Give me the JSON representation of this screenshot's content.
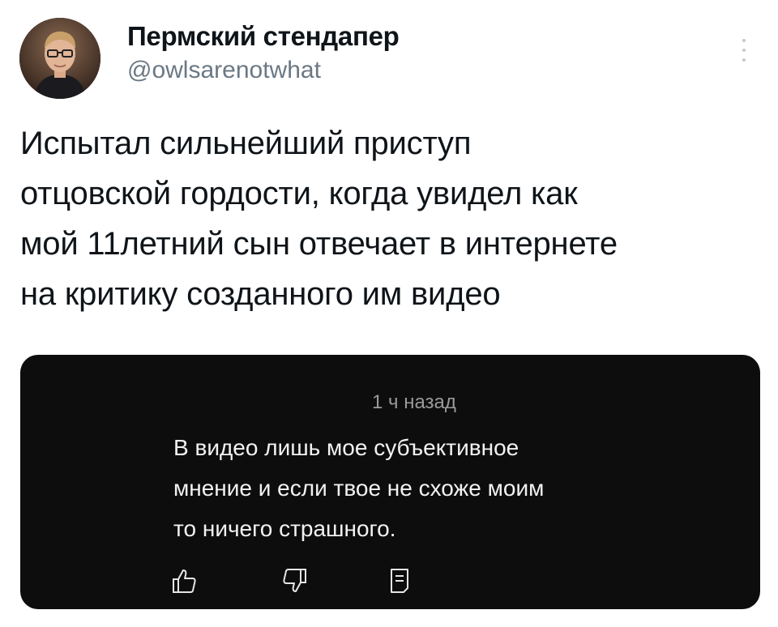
{
  "tweet": {
    "author": {
      "display_name": "Пермский стендапер",
      "handle": "@owlsarenotwhat",
      "avatar_icon": "user-avatar-photo"
    },
    "more_icon": "more-vertical-icon",
    "text": "Испытал сильнейший приступ\nотцовской гордости, когда увидел как\nмой 11летний сын отвечает в интернете\nна критику созданного им видео"
  },
  "embedded_comment": {
    "time": "1 ч назад",
    "text": "В видео лишь мое субъективное\nмнение и если твое не схоже моим\nто ничего страшного.",
    "actions": [
      {
        "icon": "thumbs-up-icon"
      },
      {
        "icon": "thumbs-down-icon"
      },
      {
        "icon": "reply-icon"
      }
    ]
  },
  "colors": {
    "background": "#ffffff",
    "text": "#0f1419",
    "secondary_text": "#6b7884",
    "card_background": "#0d0d0d",
    "card_text": "#f2f2f2",
    "card_meta_text": "#9a9a9a"
  }
}
